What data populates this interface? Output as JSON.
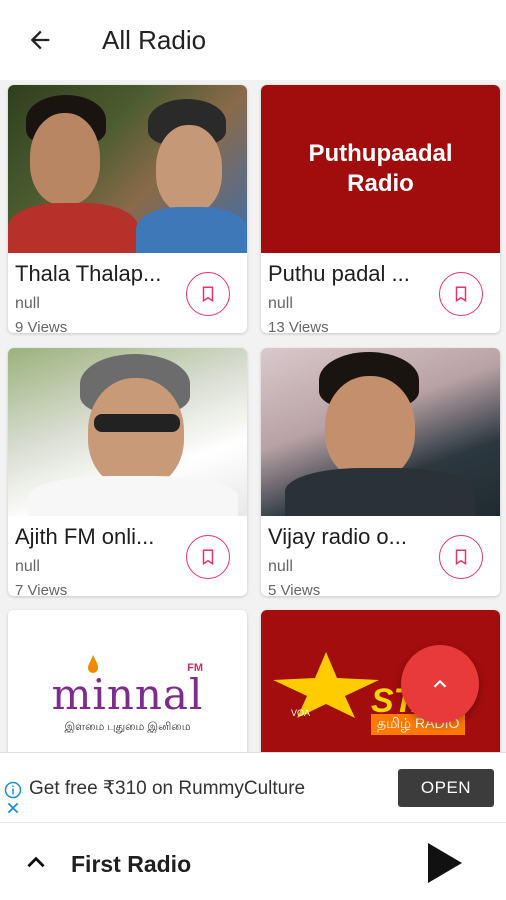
{
  "header": {
    "title": "All Radio",
    "back_icon": "arrow-left-icon"
  },
  "stations": [
    {
      "name": "Thala Thalap...",
      "subtitle": "null",
      "views": "9 Views",
      "thumb": "photo-two-actors"
    },
    {
      "name": "Puthu padal ...",
      "subtitle": "null",
      "views": "13 Views",
      "thumb": "text-logo",
      "logo_text": "Puthupaadal Radio"
    },
    {
      "name": "Ajith FM onli...",
      "subtitle": "null",
      "views": "7 Views",
      "thumb": "photo-actor-sunglasses"
    },
    {
      "name": "Vijay radio o...",
      "subtitle": "null",
      "views": "5 Views",
      "thumb": "photo-actor-smiling"
    },
    {
      "name": "",
      "subtitle": "",
      "views": "",
      "thumb": "minnal-fm-logo",
      "logo_text": "minnal",
      "logo_fm": "FM",
      "logo_tagline": "இளமை புதுமை இனிமை"
    },
    {
      "name": "",
      "subtitle": "",
      "views": "",
      "thumb": "star-tamil-radio-logo",
      "logo_text": "STAR",
      "logo_sub": "தமிழ் RADIO",
      "logo_small": "VOA"
    }
  ],
  "fab": {
    "icon": "chevron-up-icon"
  },
  "ad": {
    "text": "Get free ₹310 on RummyCulture",
    "button": "OPEN",
    "info_icon": "info-icon",
    "close_icon": "close-icon"
  },
  "player": {
    "title": "First Radio",
    "expand_icon": "chevron-up-icon",
    "play_icon": "play-icon"
  },
  "colors": {
    "accent": "#e8336a",
    "fab": "#e83a3a",
    "brand_red": "#a10d0d",
    "ad_button": "#3c3c3c"
  }
}
